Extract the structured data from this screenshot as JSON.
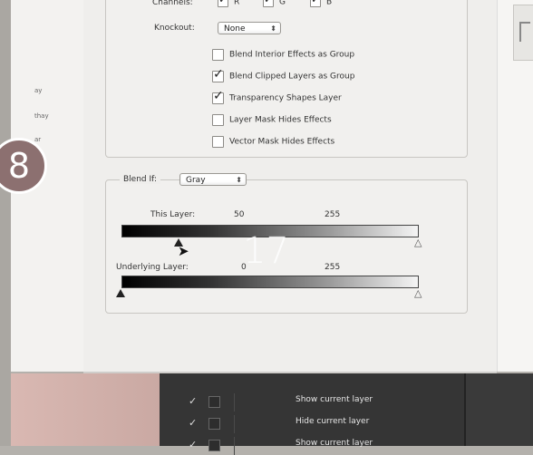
{
  "step_badge": "8",
  "overlay_number": "17",
  "left_panel": {
    "fragments": [
      "ay",
      "thay",
      "ar"
    ]
  },
  "advanced_blending": {
    "channels_label": "Channels:",
    "channels": [
      "R",
      "G",
      "B"
    ],
    "knockout_label": "Knockout:",
    "knockout_value": "None",
    "options": [
      {
        "label": "Blend Interior Effects as Group",
        "checked": false
      },
      {
        "label": "Blend Clipped Layers as Group",
        "checked": true
      },
      {
        "label": "Transparency Shapes Layer",
        "checked": true
      },
      {
        "label": "Layer Mask Hides Effects",
        "checked": false
      },
      {
        "label": "Vector Mask Hides Effects",
        "checked": false
      }
    ]
  },
  "blend_if": {
    "label": "Blend If:",
    "channel": "Gray",
    "this_layer_label": "This Layer:",
    "this_layer_low": "50",
    "this_layer_high": "255",
    "underlying_label": "Underlying Layer:",
    "underlying_low": "0",
    "underlying_high": "255"
  },
  "menu_items": [
    {
      "label": "Show current layer",
      "checked": true
    },
    {
      "label": "Hide current layer",
      "checked": true
    },
    {
      "label": "Show current layer",
      "checked": true
    }
  ],
  "colors": {
    "badge": "#8c7070",
    "dialog": "#efeeec",
    "menu_bg": "#353535"
  }
}
